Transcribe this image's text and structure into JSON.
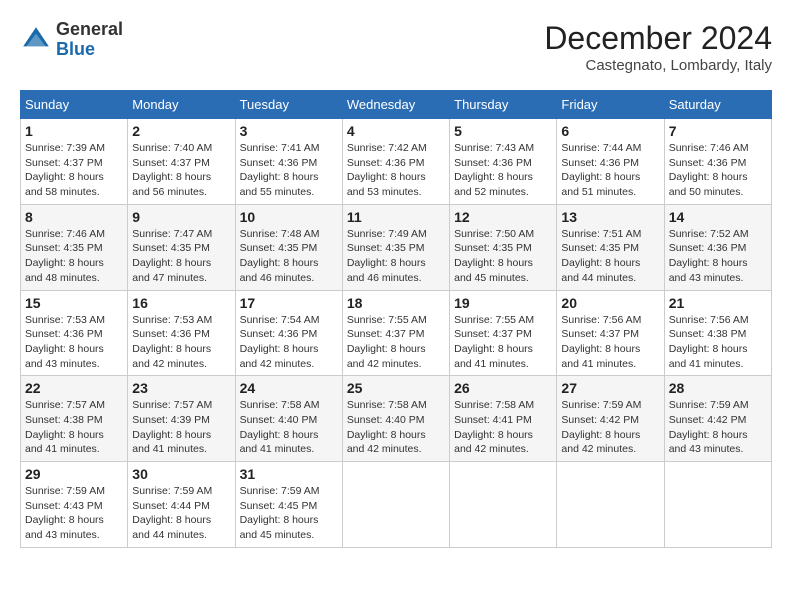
{
  "header": {
    "logo": {
      "general": "General",
      "blue": "Blue"
    },
    "title": "December 2024",
    "subtitle": "Castegnato, Lombardy, Italy"
  },
  "weekdays": [
    "Sunday",
    "Monday",
    "Tuesday",
    "Wednesday",
    "Thursday",
    "Friday",
    "Saturday"
  ],
  "weeks": [
    [
      {
        "day": "1",
        "sunrise": "Sunrise: 7:39 AM",
        "sunset": "Sunset: 4:37 PM",
        "daylight": "Daylight: 8 hours and 58 minutes."
      },
      {
        "day": "2",
        "sunrise": "Sunrise: 7:40 AM",
        "sunset": "Sunset: 4:37 PM",
        "daylight": "Daylight: 8 hours and 56 minutes."
      },
      {
        "day": "3",
        "sunrise": "Sunrise: 7:41 AM",
        "sunset": "Sunset: 4:36 PM",
        "daylight": "Daylight: 8 hours and 55 minutes."
      },
      {
        "day": "4",
        "sunrise": "Sunrise: 7:42 AM",
        "sunset": "Sunset: 4:36 PM",
        "daylight": "Daylight: 8 hours and 53 minutes."
      },
      {
        "day": "5",
        "sunrise": "Sunrise: 7:43 AM",
        "sunset": "Sunset: 4:36 PM",
        "daylight": "Daylight: 8 hours and 52 minutes."
      },
      {
        "day": "6",
        "sunrise": "Sunrise: 7:44 AM",
        "sunset": "Sunset: 4:36 PM",
        "daylight": "Daylight: 8 hours and 51 minutes."
      },
      {
        "day": "7",
        "sunrise": "Sunrise: 7:46 AM",
        "sunset": "Sunset: 4:36 PM",
        "daylight": "Daylight: 8 hours and 50 minutes."
      }
    ],
    [
      {
        "day": "8",
        "sunrise": "Sunrise: 7:46 AM",
        "sunset": "Sunset: 4:35 PM",
        "daylight": "Daylight: 8 hours and 48 minutes."
      },
      {
        "day": "9",
        "sunrise": "Sunrise: 7:47 AM",
        "sunset": "Sunset: 4:35 PM",
        "daylight": "Daylight: 8 hours and 47 minutes."
      },
      {
        "day": "10",
        "sunrise": "Sunrise: 7:48 AM",
        "sunset": "Sunset: 4:35 PM",
        "daylight": "Daylight: 8 hours and 46 minutes."
      },
      {
        "day": "11",
        "sunrise": "Sunrise: 7:49 AM",
        "sunset": "Sunset: 4:35 PM",
        "daylight": "Daylight: 8 hours and 46 minutes."
      },
      {
        "day": "12",
        "sunrise": "Sunrise: 7:50 AM",
        "sunset": "Sunset: 4:35 PM",
        "daylight": "Daylight: 8 hours and 45 minutes."
      },
      {
        "day": "13",
        "sunrise": "Sunrise: 7:51 AM",
        "sunset": "Sunset: 4:35 PM",
        "daylight": "Daylight: 8 hours and 44 minutes."
      },
      {
        "day": "14",
        "sunrise": "Sunrise: 7:52 AM",
        "sunset": "Sunset: 4:36 PM",
        "daylight": "Daylight: 8 hours and 43 minutes."
      }
    ],
    [
      {
        "day": "15",
        "sunrise": "Sunrise: 7:53 AM",
        "sunset": "Sunset: 4:36 PM",
        "daylight": "Daylight: 8 hours and 43 minutes."
      },
      {
        "day": "16",
        "sunrise": "Sunrise: 7:53 AM",
        "sunset": "Sunset: 4:36 PM",
        "daylight": "Daylight: 8 hours and 42 minutes."
      },
      {
        "day": "17",
        "sunrise": "Sunrise: 7:54 AM",
        "sunset": "Sunset: 4:36 PM",
        "daylight": "Daylight: 8 hours and 42 minutes."
      },
      {
        "day": "18",
        "sunrise": "Sunrise: 7:55 AM",
        "sunset": "Sunset: 4:37 PM",
        "daylight": "Daylight: 8 hours and 42 minutes."
      },
      {
        "day": "19",
        "sunrise": "Sunrise: 7:55 AM",
        "sunset": "Sunset: 4:37 PM",
        "daylight": "Daylight: 8 hours and 41 minutes."
      },
      {
        "day": "20",
        "sunrise": "Sunrise: 7:56 AM",
        "sunset": "Sunset: 4:37 PM",
        "daylight": "Daylight: 8 hours and 41 minutes."
      },
      {
        "day": "21",
        "sunrise": "Sunrise: 7:56 AM",
        "sunset": "Sunset: 4:38 PM",
        "daylight": "Daylight: 8 hours and 41 minutes."
      }
    ],
    [
      {
        "day": "22",
        "sunrise": "Sunrise: 7:57 AM",
        "sunset": "Sunset: 4:38 PM",
        "daylight": "Daylight: 8 hours and 41 minutes."
      },
      {
        "day": "23",
        "sunrise": "Sunrise: 7:57 AM",
        "sunset": "Sunset: 4:39 PM",
        "daylight": "Daylight: 8 hours and 41 minutes."
      },
      {
        "day": "24",
        "sunrise": "Sunrise: 7:58 AM",
        "sunset": "Sunset: 4:40 PM",
        "daylight": "Daylight: 8 hours and 41 minutes."
      },
      {
        "day": "25",
        "sunrise": "Sunrise: 7:58 AM",
        "sunset": "Sunset: 4:40 PM",
        "daylight": "Daylight: 8 hours and 42 minutes."
      },
      {
        "day": "26",
        "sunrise": "Sunrise: 7:58 AM",
        "sunset": "Sunset: 4:41 PM",
        "daylight": "Daylight: 8 hours and 42 minutes."
      },
      {
        "day": "27",
        "sunrise": "Sunrise: 7:59 AM",
        "sunset": "Sunset: 4:42 PM",
        "daylight": "Daylight: 8 hours and 42 minutes."
      },
      {
        "day": "28",
        "sunrise": "Sunrise: 7:59 AM",
        "sunset": "Sunset: 4:42 PM",
        "daylight": "Daylight: 8 hours and 43 minutes."
      }
    ],
    [
      {
        "day": "29",
        "sunrise": "Sunrise: 7:59 AM",
        "sunset": "Sunset: 4:43 PM",
        "daylight": "Daylight: 8 hours and 43 minutes."
      },
      {
        "day": "30",
        "sunrise": "Sunrise: 7:59 AM",
        "sunset": "Sunset: 4:44 PM",
        "daylight": "Daylight: 8 hours and 44 minutes."
      },
      {
        "day": "31",
        "sunrise": "Sunrise: 7:59 AM",
        "sunset": "Sunset: 4:45 PM",
        "daylight": "Daylight: 8 hours and 45 minutes."
      },
      null,
      null,
      null,
      null
    ]
  ]
}
